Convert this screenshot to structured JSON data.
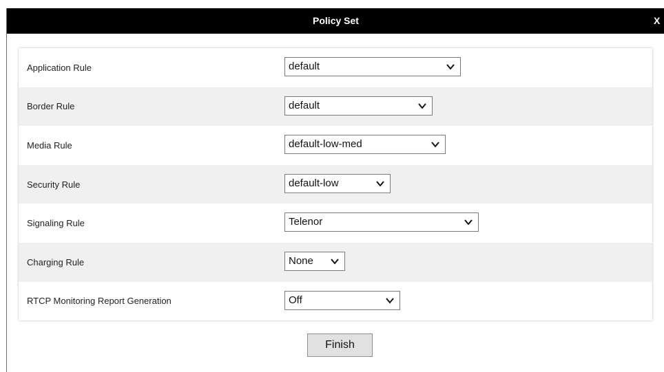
{
  "dialog": {
    "title": "Policy Set",
    "close_label": "X",
    "finish_label": "Finish"
  },
  "rules": [
    {
      "label": "Application Rule",
      "value": "default"
    },
    {
      "label": "Border Rule",
      "value": "default"
    },
    {
      "label": "Media Rule",
      "value": "default-low-med"
    },
    {
      "label": "Security Rule",
      "value": "default-low"
    },
    {
      "label": "Signaling Rule",
      "value": "Telenor"
    },
    {
      "label": "Charging Rule",
      "value": "None"
    },
    {
      "label": "RTCP Monitoring Report Generation",
      "value": "Off"
    }
  ],
  "colors": {
    "titlebar": "#000000",
    "title_text": "#ffffff",
    "panel": "#f0f0f0",
    "row_alt": "#ffffff"
  },
  "icons": {
    "dropdown": "chevron-down-icon",
    "close": "close-icon"
  }
}
